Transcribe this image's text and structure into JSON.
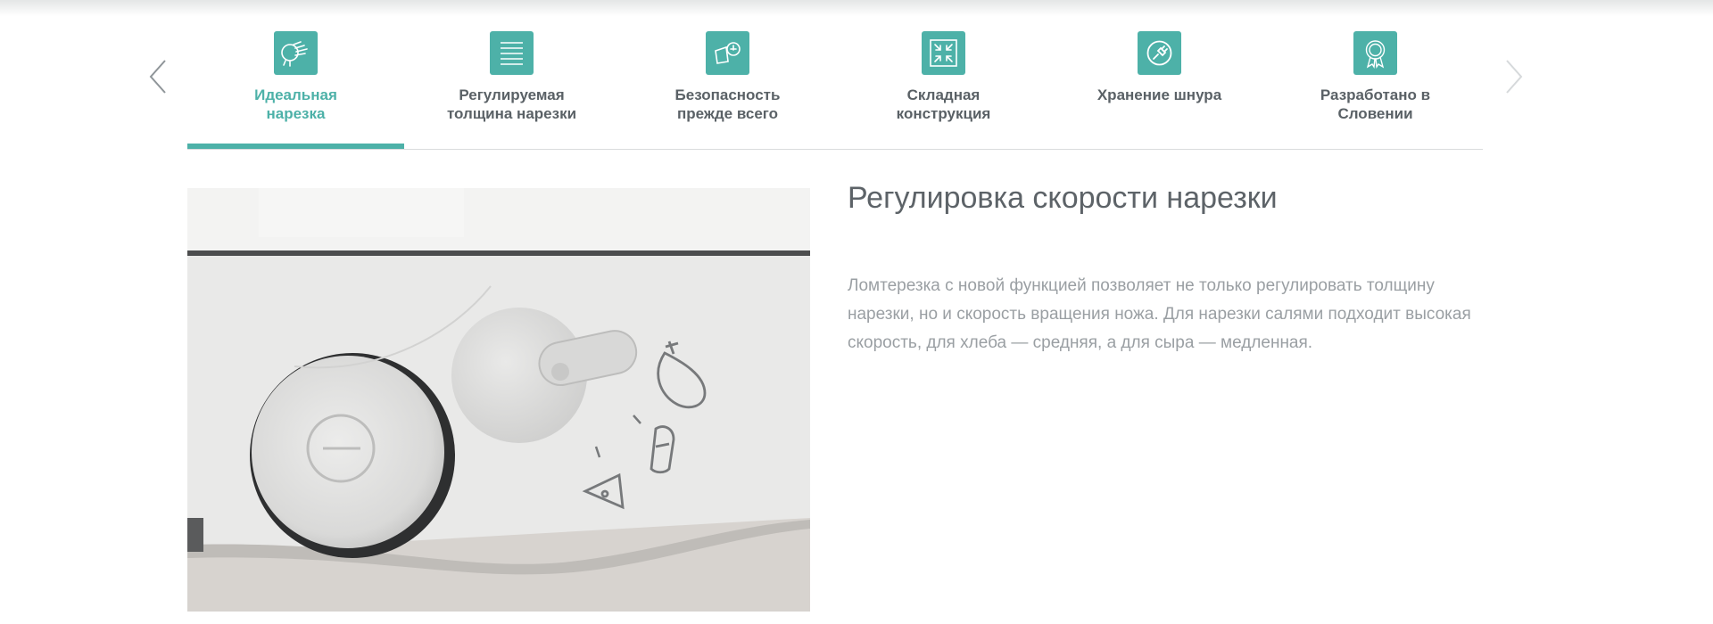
{
  "tabs": [
    {
      "label": "Идеальная\nнарезка",
      "icon": "hand-slicing-icon",
      "active": true
    },
    {
      "label": "Регулируемая\nтолщина нарезки",
      "icon": "lines-icon",
      "active": false
    },
    {
      "label": "Безопасность\nпрежде всего",
      "icon": "safety-icon",
      "active": false
    },
    {
      "label": "Складная\nконструкция",
      "icon": "fold-icon",
      "active": false
    },
    {
      "label": "Хранение шнура",
      "icon": "plug-icon",
      "active": false
    },
    {
      "label": "Разработано в\nСловении",
      "icon": "eu-badge-icon",
      "active": false
    }
  ],
  "content": {
    "heading": "Регулировка скорости нарезки",
    "description": "Ломтерезка с новой функцией позволяет не только регулировать толщину нарезки, но и скорость вращения ножа. Для нарезки салями подходит высокая скорость, для хлеба — средняя, а для сыра — медленная."
  },
  "colors": {
    "accent": "#4db1a8",
    "tab_text": "#5a6166",
    "heading": "#5d6368",
    "body_text": "#9a9fa3"
  },
  "icons": {
    "prev": "chevron-left-icon",
    "next": "chevron-right-icon",
    "photo_symbols": [
      "sausage-icon",
      "bread-icon",
      "cheese-icon"
    ]
  }
}
